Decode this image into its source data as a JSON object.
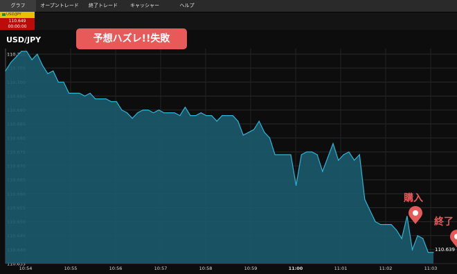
{
  "tabs": [
    {
      "label": "グラフ",
      "active": true
    },
    {
      "label": "オープントレード",
      "active": false
    },
    {
      "label": "終了トレード",
      "active": false
    },
    {
      "label": "キャッシャー",
      "active": false
    },
    {
      "label": "ヘルプ",
      "active": false
    }
  ],
  "ticker": {
    "symbol": "USD/JPY",
    "price": "110.649",
    "timer": "00:00:00"
  },
  "chart_title": "USD/JPY",
  "banner": "予想ハズレ!!失敗",
  "buy_label": "購入",
  "end_label": "終了",
  "last_price_label": "110.639",
  "colors": {
    "line": "#2fb6d8",
    "fill": "#1b5a6b",
    "marker": "#e85a5a",
    "ticker_bg": "#bb0b0b"
  },
  "chart_data": {
    "type": "area",
    "title": "USD/JPY",
    "xlabel": "",
    "ylabel": "",
    "ylim": [
      110.635,
      110.712
    ],
    "x_ticks": [
      "10:54",
      "10:55",
      "10:56",
      "10:57",
      "10:58",
      "10:59",
      "11:00",
      "11:01",
      "11:02",
      "11:03"
    ],
    "y_ticks": [
      "110.710",
      "110.705",
      "110.700",
      "110.695",
      "110.690",
      "110.685",
      "110.680",
      "110.675",
      "110.670",
      "110.665",
      "110.660",
      "110.655",
      "110.650",
      "110.645",
      "110.640",
      "110.635"
    ],
    "grid": true,
    "series": [
      {
        "values": [
          110.704,
          110.707,
          110.709,
          110.711,
          110.711,
          110.708,
          110.71,
          110.706,
          110.703,
          110.704,
          110.7,
          110.7,
          110.696,
          110.696,
          110.696,
          110.695,
          110.696,
          110.694,
          110.694,
          110.694,
          110.693,
          110.693,
          110.69,
          110.689,
          110.687,
          110.689,
          110.69,
          110.69,
          110.689,
          110.69,
          110.689,
          110.689,
          110.689,
          110.688,
          110.691,
          110.688,
          110.688,
          110.689,
          110.688,
          110.688,
          110.686,
          110.688,
          110.688,
          110.688,
          110.686,
          110.681,
          110.682,
          110.683,
          110.686,
          110.682,
          110.68,
          110.674,
          110.674,
          110.674,
          110.674,
          110.663,
          110.674,
          110.675,
          110.675,
          110.674,
          110.668,
          110.673,
          110.678,
          110.672,
          110.674,
          110.675,
          110.672,
          110.674,
          110.658,
          110.654,
          110.65,
          110.649,
          110.649,
          110.649,
          110.647,
          110.644,
          110.652,
          110.64,
          110.645,
          110.644,
          110.639,
          110.639
        ]
      }
    ]
  }
}
